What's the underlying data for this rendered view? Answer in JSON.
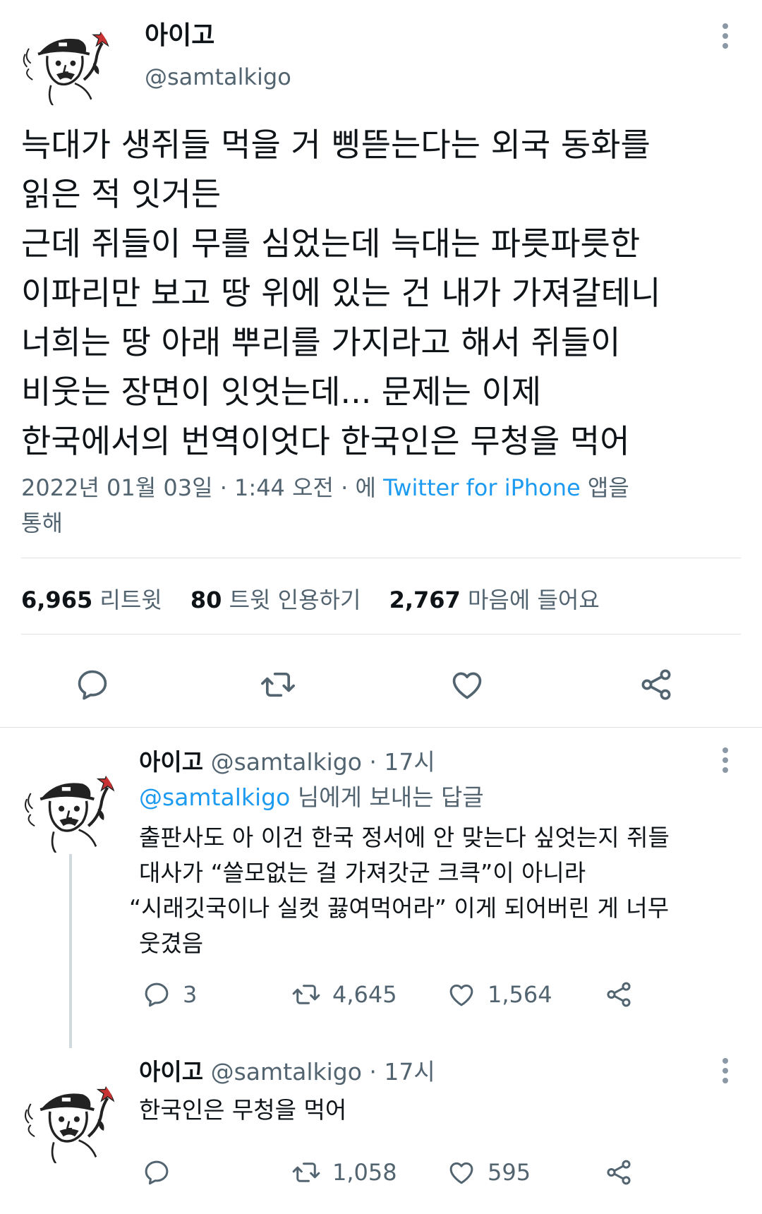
{
  "main_tweet": {
    "name": "아이고",
    "handle": "@samtalkigo",
    "text_lines": [
      "늑대가 생쥐들 먹을 거 삥뜯는다는 외국 동화를",
      "읽은 적 잇거든",
      "근데 쥐들이 무를 심었는데 늑대는 파릇파릇한",
      "이파리만 보고 땅 위에 있는 건 내가 가져갈테니",
      "너희는 땅 아래 뿌리를 가지라고 해서 쥐들이",
      "비웃는 장면이 잇엇는데... 문제는 이제",
      "한국에서의 번역이엇다 한국인은 무청을 먹어"
    ],
    "timestamp": "2022년 01월 03일 · 1:44 오전 · 에",
    "source": "Twitter for iPhone",
    "source_suffix": "앱을",
    "source_suffix2": "통해",
    "stats": {
      "retweets": "6,965",
      "retweets_label": "리트윗",
      "quotes": "80",
      "quotes_label": "트윗 인용하기",
      "likes": "2,767",
      "likes_label": "마음에 들어요"
    },
    "actions": [
      "reply-icon",
      "retweet-icon",
      "like-icon",
      "share-icon"
    ]
  },
  "replies": [
    {
      "name": "아이고",
      "handle": "@samtalkigo · 17시",
      "replying_to_mention": "@samtalkigo",
      "replying_to_suffix": "님에게 보내는 답글",
      "text_lines": [
        "출판사도 아 이건 한국 정서에 안 맞는다 싶엇는지 쥐들",
        "대사가 “쓸모없는 걸 가져갓군 크큭”이 아니라",
        "“시래깃국이나 실컷 끓여먹어라” 이게 되어버린 게 너무",
        "웃겼음"
      ],
      "reply_count": "3",
      "retweet_count": "4,645",
      "like_count": "1,564"
    },
    {
      "name": "아이고",
      "handle": "@samtalkigo · 17시",
      "text_lines": [
        "한국인은 무청을 먹어"
      ],
      "reply_count": "",
      "retweet_count": "1,058",
      "like_count": "595"
    }
  ],
  "colors": {
    "link": "#1d9bf0",
    "muted": "#536471",
    "text": "#0f1419",
    "divider": "#dfe3e6"
  }
}
